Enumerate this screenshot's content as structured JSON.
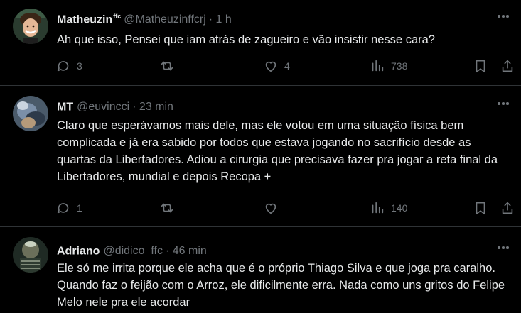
{
  "tweets": [
    {
      "name": "Matheuzin",
      "badge": "ffc",
      "handle": "@Matheuzinffcrj",
      "time": "· 1 h",
      "text": "Ah que isso, Pensei que iam atrás de zagueiro e vão insistir nesse cara?",
      "replies": "3",
      "retweets": "",
      "likes": "4",
      "views": "738"
    },
    {
      "name": "MT",
      "badge": "",
      "handle": "@euvincci",
      "time": "· 23 min",
      "text": "Claro que esperávamos mais dele, mas ele votou em uma situação física bem complicada e já era sabido por todos que estava jogando no sacrifício desde as quartas da Libertadores. Adiou a cirurgia que precisava fazer pra jogar a reta final da Libertadores, mundial e depois Recopa +",
      "replies": "1",
      "retweets": "",
      "likes": "",
      "views": "140"
    },
    {
      "name": "Adriano",
      "badge": "",
      "handle": "@didico_ffc",
      "time": "· 46 min",
      "text": "Ele só me irrita porque ele acha que é o próprio Thiago Silva e que joga pra caralho. Quando faz o feijão com o Arroz, ele dificilmente erra. Nada como uns gritos do Felipe Melo nele pra ele acordar",
      "replies": "",
      "retweets": "",
      "likes": "",
      "views": ""
    }
  ],
  "icons": {
    "reply": "reply-icon",
    "retweet": "retweet-icon",
    "like": "heart-icon",
    "views": "views-icon",
    "bookmark": "bookmark-icon",
    "share": "share-icon",
    "more": "more-icon"
  },
  "colors": {
    "background": "#000000",
    "text": "#e7e9ea",
    "muted": "#71767b",
    "divider": "#2f3336"
  }
}
